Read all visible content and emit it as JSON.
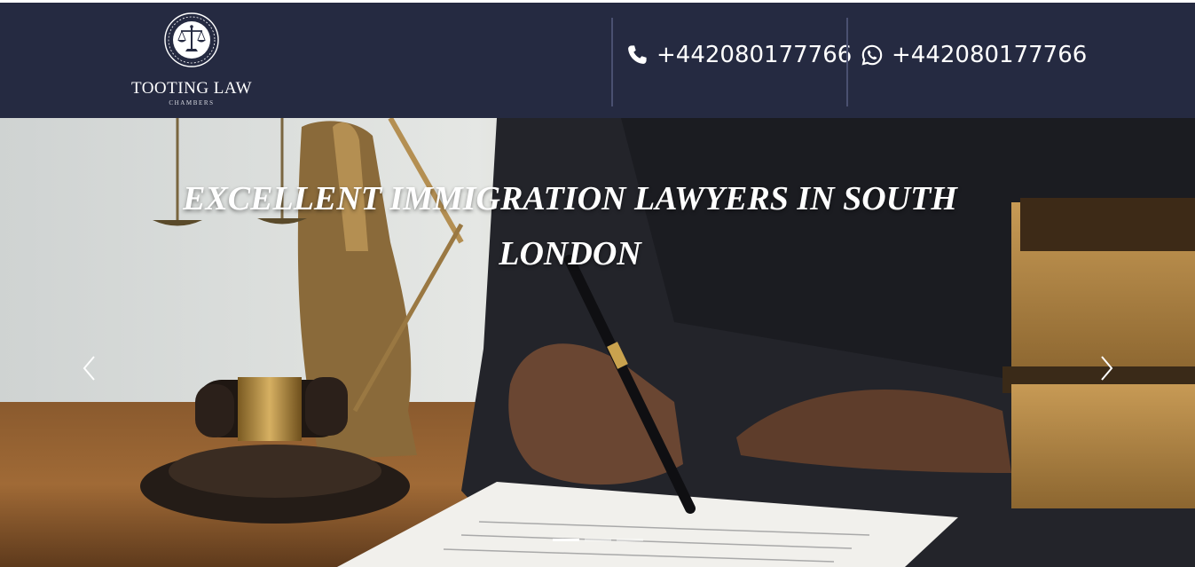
{
  "header": {
    "logo": {
      "name": "TOOTING LAW",
      "subtitle": "CHAMBERS"
    },
    "phone": {
      "icon": "phone-icon",
      "number": "+442080177766"
    },
    "whatsapp": {
      "icon": "whatsapp-icon",
      "number": "+442080177766"
    }
  },
  "hero": {
    "title": "EXCELLENT IMMIGRATION LAWYERS IN SOUTH LONDON",
    "prev_icon": "chevron-left-icon",
    "next_icon": "chevron-right-icon",
    "slides_total": 3,
    "active_slide": 1
  },
  "colors": {
    "header_bg": "#252a41",
    "text": "#ffffff",
    "separator": "#4a5070"
  }
}
